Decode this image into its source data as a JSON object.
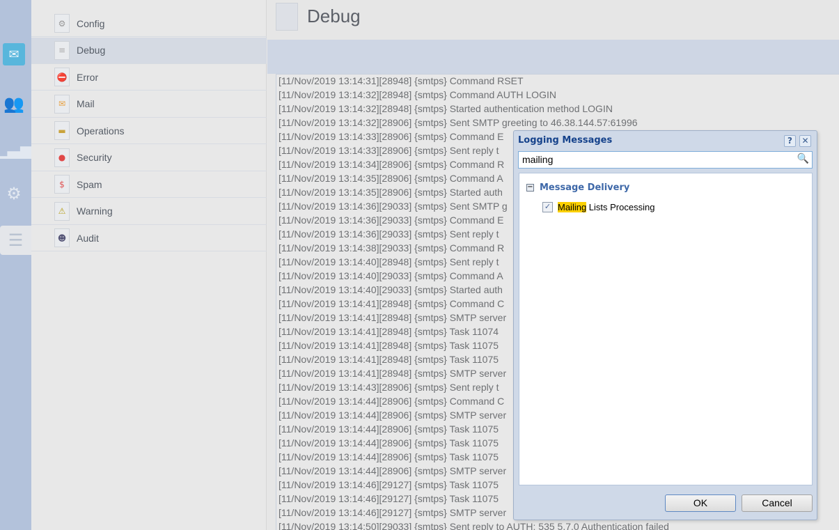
{
  "rail": {
    "icons": [
      "mail-icon",
      "users-icon",
      "stats-icon",
      "gear-icon",
      "logs-icon"
    ]
  },
  "menu": {
    "items": [
      {
        "label": "Config",
        "icon": "gear-doc-icon"
      },
      {
        "label": "Debug",
        "icon": "document-icon",
        "active": true
      },
      {
        "label": "Error",
        "icon": "error-icon"
      },
      {
        "label": "Mail",
        "icon": "envelope-icon"
      },
      {
        "label": "Operations",
        "icon": "database-icon"
      },
      {
        "label": "Security",
        "icon": "shield-icon"
      },
      {
        "label": "Spam",
        "icon": "dollar-icon"
      },
      {
        "label": "Warning",
        "icon": "warning-icon"
      },
      {
        "label": "Audit",
        "icon": "user-icon"
      }
    ]
  },
  "header": {
    "title": "Debug"
  },
  "log": {
    "lines": [
      "[11/Nov/2019 13:14:31][28948] {smtps} Command RSET",
      "[11/Nov/2019 13:14:32][28948] {smtps} Command AUTH LOGIN",
      "[11/Nov/2019 13:14:32][28948] {smtps} Started authentication method LOGIN",
      "[11/Nov/2019 13:14:32][28906] {smtps} Sent SMTP greeting to 46.38.144.57:61996",
      "[11/Nov/2019 13:14:33][28906] {smtps} Command E",
      "[11/Nov/2019 13:14:33][28906] {smtps} Sent reply t",
      "[11/Nov/2019 13:14:34][28906] {smtps} Command R",
      "[11/Nov/2019 13:14:35][28906] {smtps} Command A",
      "[11/Nov/2019 13:14:35][28906] {smtps} Started auth",
      "[11/Nov/2019 13:14:36][29033] {smtps} Sent SMTP g",
      "[11/Nov/2019 13:14:36][29033] {smtps} Command E",
      "[11/Nov/2019 13:14:36][29033] {smtps} Sent reply t",
      "[11/Nov/2019 13:14:38][29033] {smtps} Command R",
      "[11/Nov/2019 13:14:40][28948] {smtps} Sent reply t",
      "[11/Nov/2019 13:14:40][29033] {smtps} Command A",
      "[11/Nov/2019 13:14:40][29033] {smtps} Started auth",
      "[11/Nov/2019 13:14:41][28948] {smtps} Command C",
      "[11/Nov/2019 13:14:41][28948] {smtps} SMTP server",
      "[11/Nov/2019 13:14:41][28948] {smtps} Task 11074",
      "[11/Nov/2019 13:14:41][28948] {smtps} Task 11075",
      "[11/Nov/2019 13:14:41][28948] {smtps} Task 11075",
      "[11/Nov/2019 13:14:41][28948] {smtps} SMTP server",
      "[11/Nov/2019 13:14:43][28906] {smtps} Sent reply t",
      "[11/Nov/2019 13:14:44][28906] {smtps} Command C",
      "[11/Nov/2019 13:14:44][28906] {smtps} SMTP server",
      "[11/Nov/2019 13:14:44][28906] {smtps} Task 11075",
      "[11/Nov/2019 13:14:44][28906] {smtps} Task 11075",
      "[11/Nov/2019 13:14:44][28906] {smtps} Task 11075",
      "[11/Nov/2019 13:14:44][28906] {smtps} SMTP server",
      "[11/Nov/2019 13:14:46][29127] {smtps} Task 11075",
      "[11/Nov/2019 13:14:46][29127] {smtps} Task 11075",
      "[11/Nov/2019 13:14:46][29127] {smtps} SMTP server",
      "[11/Nov/2019 13:14:50][29033] {smtps} Sent reply to AUTH: 535 5.7.0 Authentication failed"
    ]
  },
  "dialog": {
    "title": "Logging Messages",
    "help": "?",
    "close": "✕",
    "search_value": "mailing",
    "group": "Message Delivery",
    "item_highlight": "Mailing",
    "item_rest": " Lists Processing",
    "item_checked": true,
    "ok": "OK",
    "cancel": "Cancel"
  }
}
